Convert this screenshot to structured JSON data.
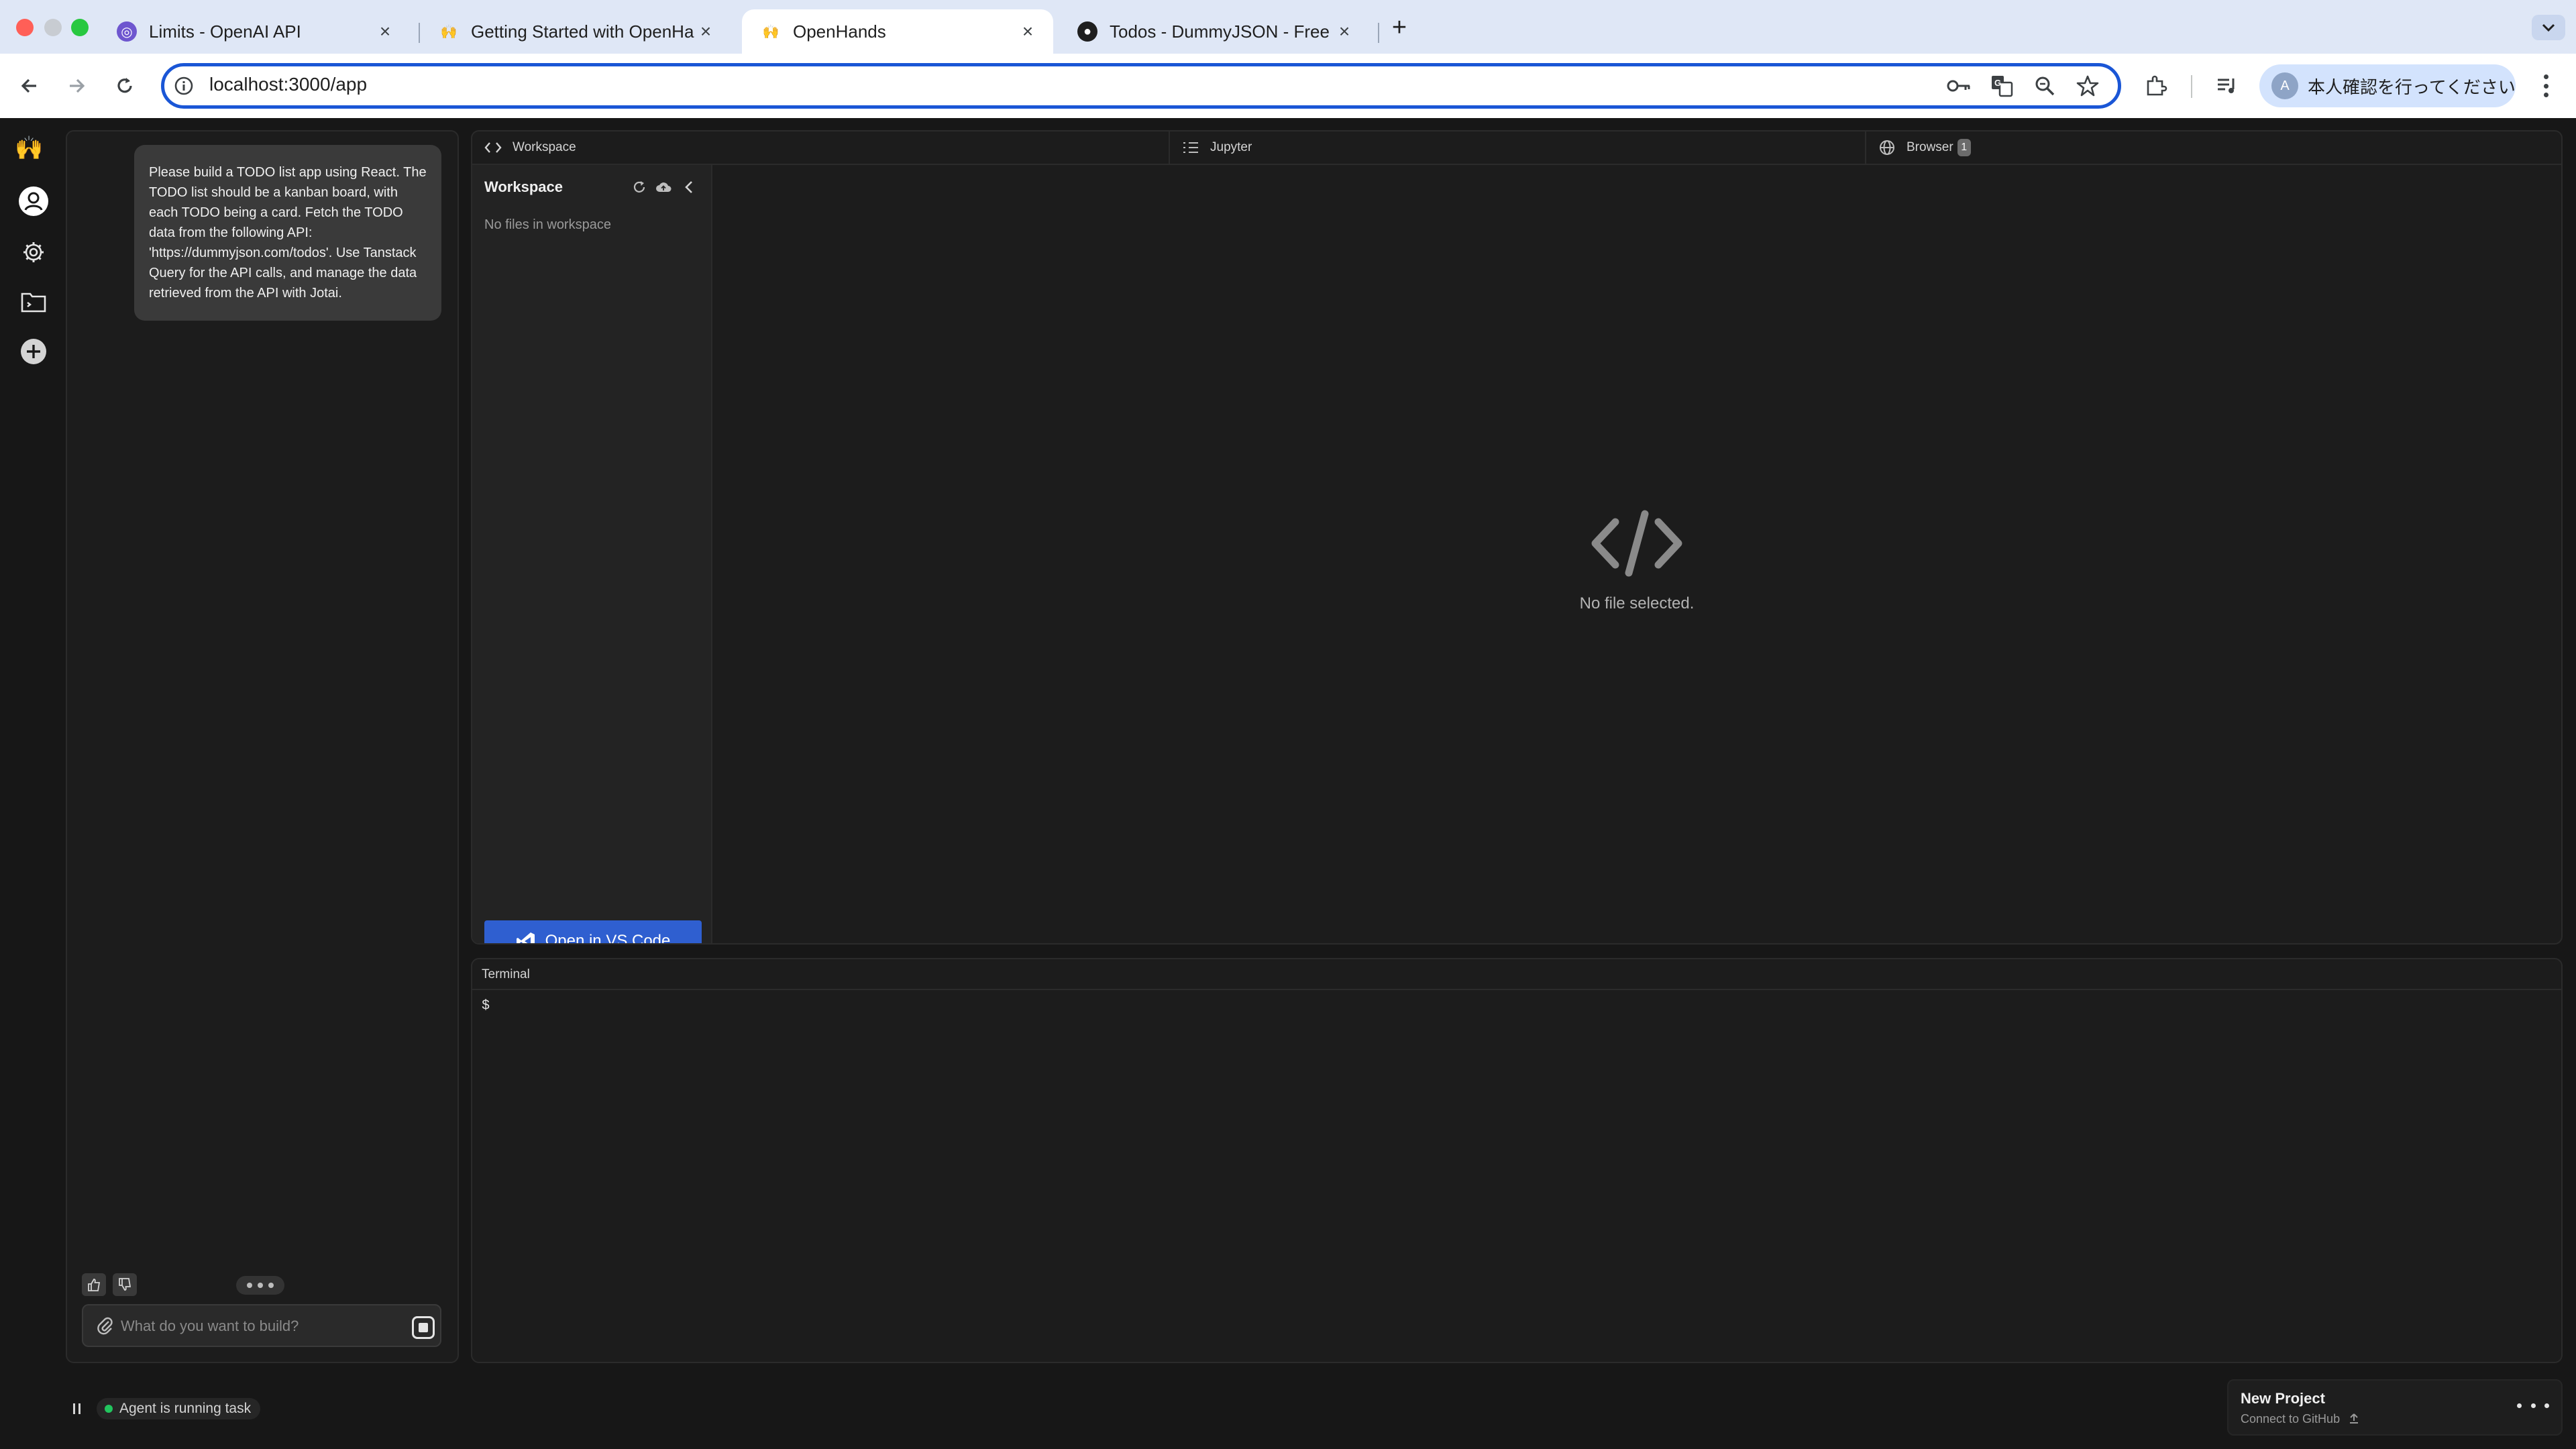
{
  "browser": {
    "tabs": [
      {
        "label": "Limits - OpenAI API",
        "icon": "openai-icon",
        "active": false
      },
      {
        "label": "Getting Started with OpenHands",
        "icon": "openhands-icon",
        "active": false
      },
      {
        "label": "OpenHands",
        "icon": "openhands-icon",
        "active": true
      },
      {
        "label": "Todos - DummyJSON - Free Fake REST API",
        "icon": "github-icon",
        "active": false
      }
    ],
    "url": "localhost:3000/app",
    "profile_label": "本人確認を行ってください"
  },
  "chat": {
    "user_message": "Please build a TODO list app using React. The TODO list should be a kanban board, with each TODO being a card. Fetch the TODO data from the following API: 'https://dummyjson.com/todos'. Use Tanstack Query for the API calls, and manage the data retrieved from the API with Jotai.",
    "input_placeholder": "What do you want to build?",
    "agent_status": "Agent is running task"
  },
  "workspace": {
    "tabs": [
      {
        "label": "Workspace",
        "icon": "code-icon"
      },
      {
        "label": "Jupyter",
        "icon": "jupyter-icon"
      },
      {
        "label": "Browser",
        "icon": "globe-icon",
        "badge": "1"
      }
    ],
    "tree_title": "Workspace",
    "empty_files": "No files in workspace",
    "vscode_button": "Open in VS Code",
    "no_file_selected": "No file selected."
  },
  "terminal": {
    "title": "Terminal",
    "prompt": "$"
  },
  "project": {
    "name": "New Project",
    "subtitle": "Connect to GitHub"
  },
  "colors": {
    "accent": "#2f5fd0",
    "running": "#22c55e",
    "background": "#171717"
  }
}
